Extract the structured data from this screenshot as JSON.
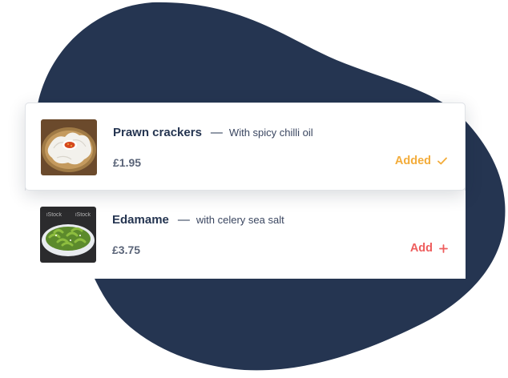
{
  "menu": {
    "items": [
      {
        "name": "Prawn crackers",
        "separator": "—",
        "description": "With spicy chilli oil",
        "price": "£1.95",
        "action_label": "Added",
        "action_icon": "check-icon",
        "action_color": "#f3ac3a"
      },
      {
        "name": "Edamame",
        "separator": "—",
        "description": "with celery sea salt",
        "price": "£3.75",
        "action_label": "Add",
        "action_icon": "plus-icon",
        "action_color": "#ee5d5d",
        "image_watermark": "iStock"
      }
    ]
  },
  "colors": {
    "blob": "#253551",
    "title": "#253551",
    "price": "#5a6478"
  }
}
